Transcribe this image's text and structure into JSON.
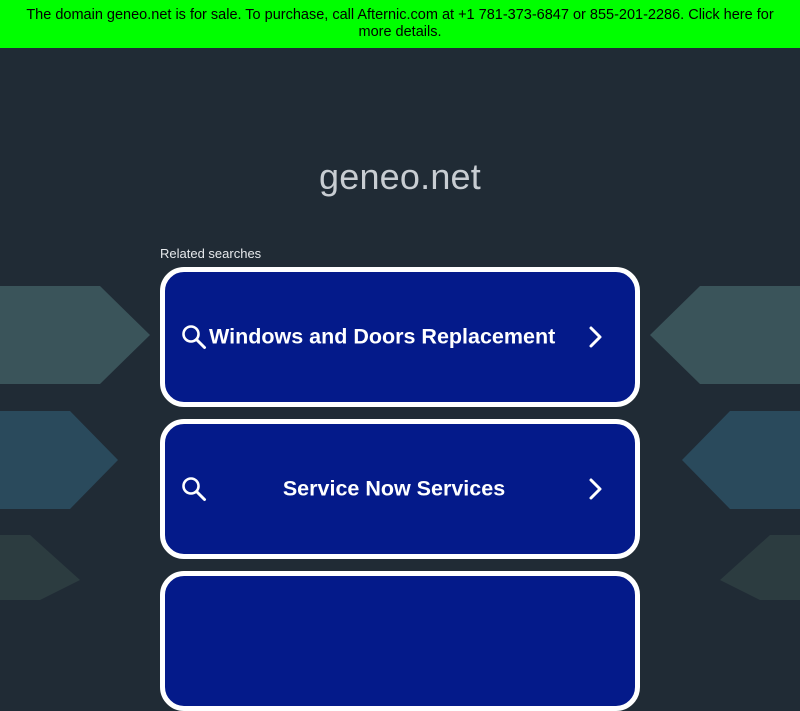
{
  "banner": {
    "text": "The domain geneo.net is for sale. To purchase, call Afternic.com at +1 781-373-6847 or 855-201-2286. Click here for more details."
  },
  "domain": "geneo.net",
  "related": {
    "label": "Related searches",
    "items": [
      {
        "label": "Windows and Doors Replacement"
      },
      {
        "label": "Service Now Services"
      },
      {
        "label": ""
      }
    ]
  },
  "icons": {
    "search": "magnifier-icon",
    "arrow": "chevron-right-icon"
  },
  "colors": {
    "banner_bg": "#00ff00",
    "page_bg": "#202b35",
    "button_bg": "#041a8a",
    "button_border": "#ffffff",
    "title": "#c8cdd2"
  }
}
